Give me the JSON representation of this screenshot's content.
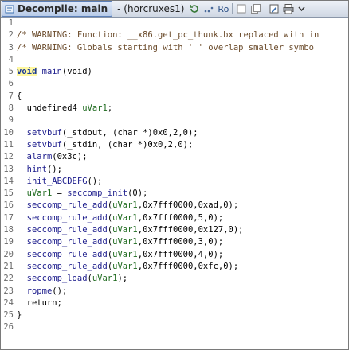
{
  "titlebar": {
    "tab_label": "Decompile: main",
    "subtitle": "- (horcruxes1)",
    "btn_ro": "Ro"
  },
  "code_lines": [
    {
      "n": "1",
      "segs": []
    },
    {
      "n": "2",
      "segs": [
        {
          "c": "c-comment",
          "t": "/* WARNING: Function: __x86.get_pc_thunk.bx replaced with in"
        }
      ]
    },
    {
      "n": "3",
      "segs": [
        {
          "c": "c-comment",
          "t": "/* WARNING: Globals starting with '_' overlap smaller symbo"
        }
      ]
    },
    {
      "n": "4",
      "segs": []
    },
    {
      "n": "5",
      "segs": [
        {
          "c": "c-kw",
          "t": "void"
        },
        {
          "c": "",
          "t": " "
        },
        {
          "c": "c-fn",
          "t": "main"
        },
        {
          "c": "",
          "t": "(void)"
        }
      ]
    },
    {
      "n": "6",
      "segs": []
    },
    {
      "n": "7",
      "segs": [
        {
          "c": "",
          "t": "{"
        }
      ]
    },
    {
      "n": "8",
      "segs": [
        {
          "c": "",
          "t": "  undefined4 "
        },
        {
          "c": "c-var",
          "t": "uVar1"
        },
        {
          "c": "",
          "t": ";"
        }
      ]
    },
    {
      "n": "9",
      "segs": []
    },
    {
      "n": "10",
      "segs": [
        {
          "c": "",
          "t": "  "
        },
        {
          "c": "c-fn",
          "t": "setvbuf"
        },
        {
          "c": "",
          "t": "(_stdout, (char *)0x0,2,0);"
        }
      ]
    },
    {
      "n": "11",
      "segs": [
        {
          "c": "",
          "t": "  "
        },
        {
          "c": "c-fn",
          "t": "setvbuf"
        },
        {
          "c": "",
          "t": "(_stdin, (char *)0x0,2,0);"
        }
      ]
    },
    {
      "n": "12",
      "segs": [
        {
          "c": "",
          "t": "  "
        },
        {
          "c": "c-fn",
          "t": "alarm"
        },
        {
          "c": "",
          "t": "(0x3c);"
        }
      ]
    },
    {
      "n": "13",
      "segs": [
        {
          "c": "",
          "t": "  "
        },
        {
          "c": "c-fn",
          "t": "hint"
        },
        {
          "c": "",
          "t": "();"
        }
      ]
    },
    {
      "n": "14",
      "segs": [
        {
          "c": "",
          "t": "  "
        },
        {
          "c": "c-fn",
          "t": "init_ABCDEFG"
        },
        {
          "c": "",
          "t": "();"
        }
      ]
    },
    {
      "n": "15",
      "segs": [
        {
          "c": "",
          "t": "  "
        },
        {
          "c": "c-var",
          "t": "uVar1"
        },
        {
          "c": "",
          "t": " = "
        },
        {
          "c": "c-fn",
          "t": "seccomp_init"
        },
        {
          "c": "",
          "t": "(0);"
        }
      ]
    },
    {
      "n": "16",
      "segs": [
        {
          "c": "",
          "t": "  "
        },
        {
          "c": "c-fn",
          "t": "seccomp_rule_add"
        },
        {
          "c": "",
          "t": "("
        },
        {
          "c": "c-var",
          "t": "uVar1"
        },
        {
          "c": "",
          "t": ",0x7fff0000,0xad,0);"
        }
      ]
    },
    {
      "n": "17",
      "segs": [
        {
          "c": "",
          "t": "  "
        },
        {
          "c": "c-fn",
          "t": "seccomp_rule_add"
        },
        {
          "c": "",
          "t": "("
        },
        {
          "c": "c-var",
          "t": "uVar1"
        },
        {
          "c": "",
          "t": ",0x7fff0000,5,0);"
        }
      ]
    },
    {
      "n": "18",
      "segs": [
        {
          "c": "",
          "t": "  "
        },
        {
          "c": "c-fn",
          "t": "seccomp_rule_add"
        },
        {
          "c": "",
          "t": "("
        },
        {
          "c": "c-var",
          "t": "uVar1"
        },
        {
          "c": "",
          "t": ",0x7fff0000,0x127,0);"
        }
      ]
    },
    {
      "n": "19",
      "segs": [
        {
          "c": "",
          "t": "  "
        },
        {
          "c": "c-fn",
          "t": "seccomp_rule_add"
        },
        {
          "c": "",
          "t": "("
        },
        {
          "c": "c-var",
          "t": "uVar1"
        },
        {
          "c": "",
          "t": ",0x7fff0000,3,0);"
        }
      ]
    },
    {
      "n": "20",
      "segs": [
        {
          "c": "",
          "t": "  "
        },
        {
          "c": "c-fn",
          "t": "seccomp_rule_add"
        },
        {
          "c": "",
          "t": "("
        },
        {
          "c": "c-var",
          "t": "uVar1"
        },
        {
          "c": "",
          "t": ",0x7fff0000,4,0);"
        }
      ]
    },
    {
      "n": "21",
      "segs": [
        {
          "c": "",
          "t": "  "
        },
        {
          "c": "c-fn",
          "t": "seccomp_rule_add"
        },
        {
          "c": "",
          "t": "("
        },
        {
          "c": "c-var",
          "t": "uVar1"
        },
        {
          "c": "",
          "t": ",0x7fff0000,0xfc,0);"
        }
      ]
    },
    {
      "n": "22",
      "segs": [
        {
          "c": "",
          "t": "  "
        },
        {
          "c": "c-fn",
          "t": "seccomp_load"
        },
        {
          "c": "",
          "t": "("
        },
        {
          "c": "c-var",
          "t": "uVar1"
        },
        {
          "c": "",
          "t": ");"
        }
      ]
    },
    {
      "n": "23",
      "segs": [
        {
          "c": "",
          "t": "  "
        },
        {
          "c": "c-fn",
          "t": "ropme"
        },
        {
          "c": "",
          "t": "();"
        }
      ]
    },
    {
      "n": "24",
      "segs": [
        {
          "c": "",
          "t": "  return;"
        }
      ]
    },
    {
      "n": "25",
      "segs": [
        {
          "c": "",
          "t": "}"
        }
      ]
    },
    {
      "n": "26",
      "segs": []
    }
  ]
}
